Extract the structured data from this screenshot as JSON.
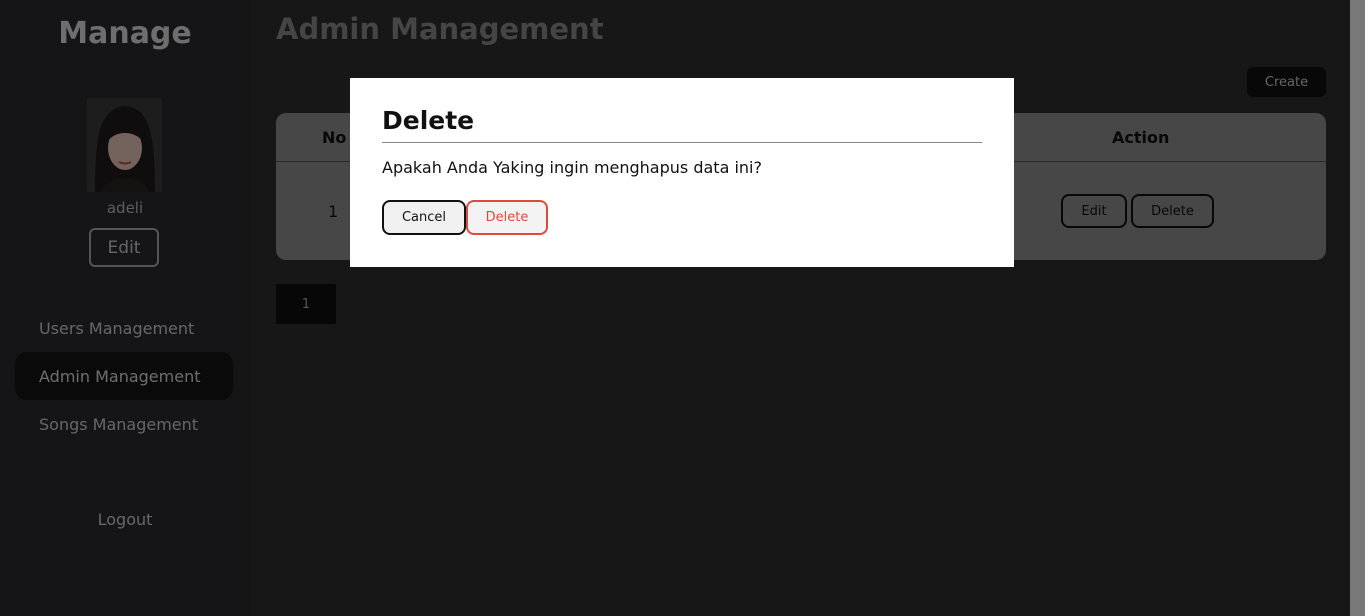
{
  "sidebar": {
    "brand": "Manage",
    "username": "adeli",
    "edit_label": "Edit",
    "nav": [
      {
        "label": "Users Management",
        "active": false
      },
      {
        "label": "Admin Management",
        "active": true
      },
      {
        "label": "Songs Management",
        "active": false
      }
    ],
    "logout_label": "Logout"
  },
  "main": {
    "title": "Admin Management",
    "create_label": "Create",
    "table": {
      "headers": {
        "no": "No",
        "action": "Action"
      },
      "rows": [
        {
          "no": "1",
          "edit_label": "Edit",
          "delete_label": "Delete"
        }
      ]
    },
    "pagination": {
      "current_page": "1"
    }
  },
  "modal": {
    "title": "Delete",
    "message": "Apakah Anda Yaking ingin menghapus data ini?",
    "cancel_label": "Cancel",
    "delete_label": "Delete"
  },
  "colors": {
    "overlay": "#000000",
    "danger": "#e04a3a",
    "modal_bg": "#ffffff"
  },
  "icons": {
    "avatar": "user-photo"
  }
}
